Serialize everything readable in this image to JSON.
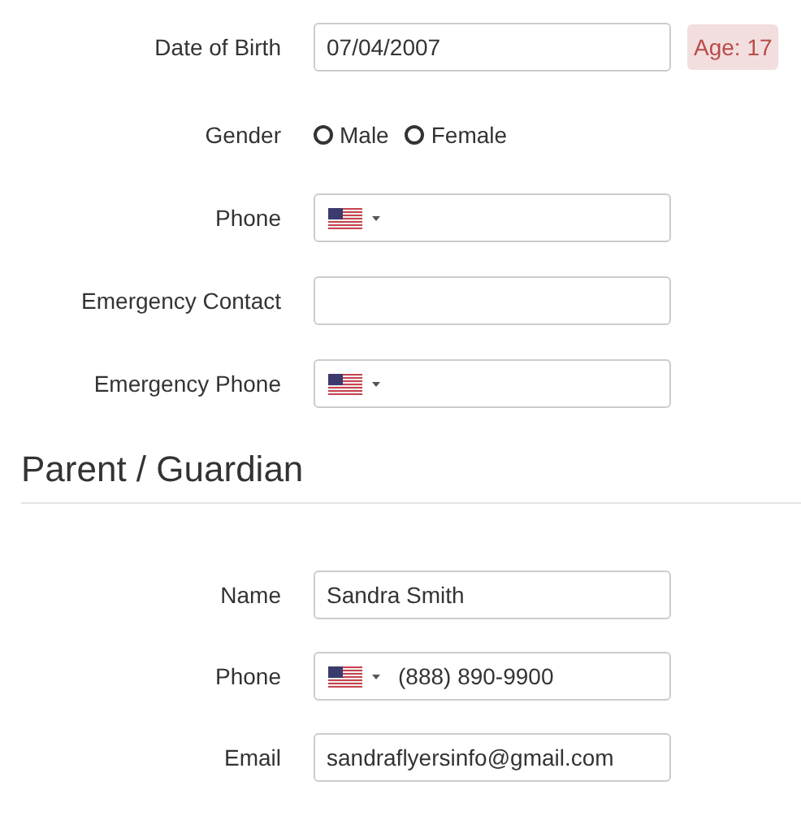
{
  "student_fields": [
    {
      "kind": "date",
      "label": "Date of Birth",
      "value": "07/04/2007",
      "badge": "Age: 17"
    },
    {
      "kind": "radio",
      "label": "Gender",
      "options": [
        {
          "label": "Male",
          "selected": false
        },
        {
          "label": "Female",
          "selected": false
        }
      ]
    },
    {
      "kind": "phone",
      "label": "Phone"
    },
    {
      "kind": "text",
      "label": "Emergency Contact"
    },
    {
      "kind": "phone",
      "label": "Emergency Phone"
    }
  ],
  "section_title": "Parent / Guardian",
  "guardian_fields": [
    {
      "kind": "text",
      "label": "Name",
      "value": "Sandra Smith"
    },
    {
      "kind": "phone",
      "label": "Phone",
      "value": "(888) 890-9900"
    },
    {
      "kind": "text",
      "label": "Email",
      "value": "sandraflyersinfo@gmail.com"
    }
  ]
}
